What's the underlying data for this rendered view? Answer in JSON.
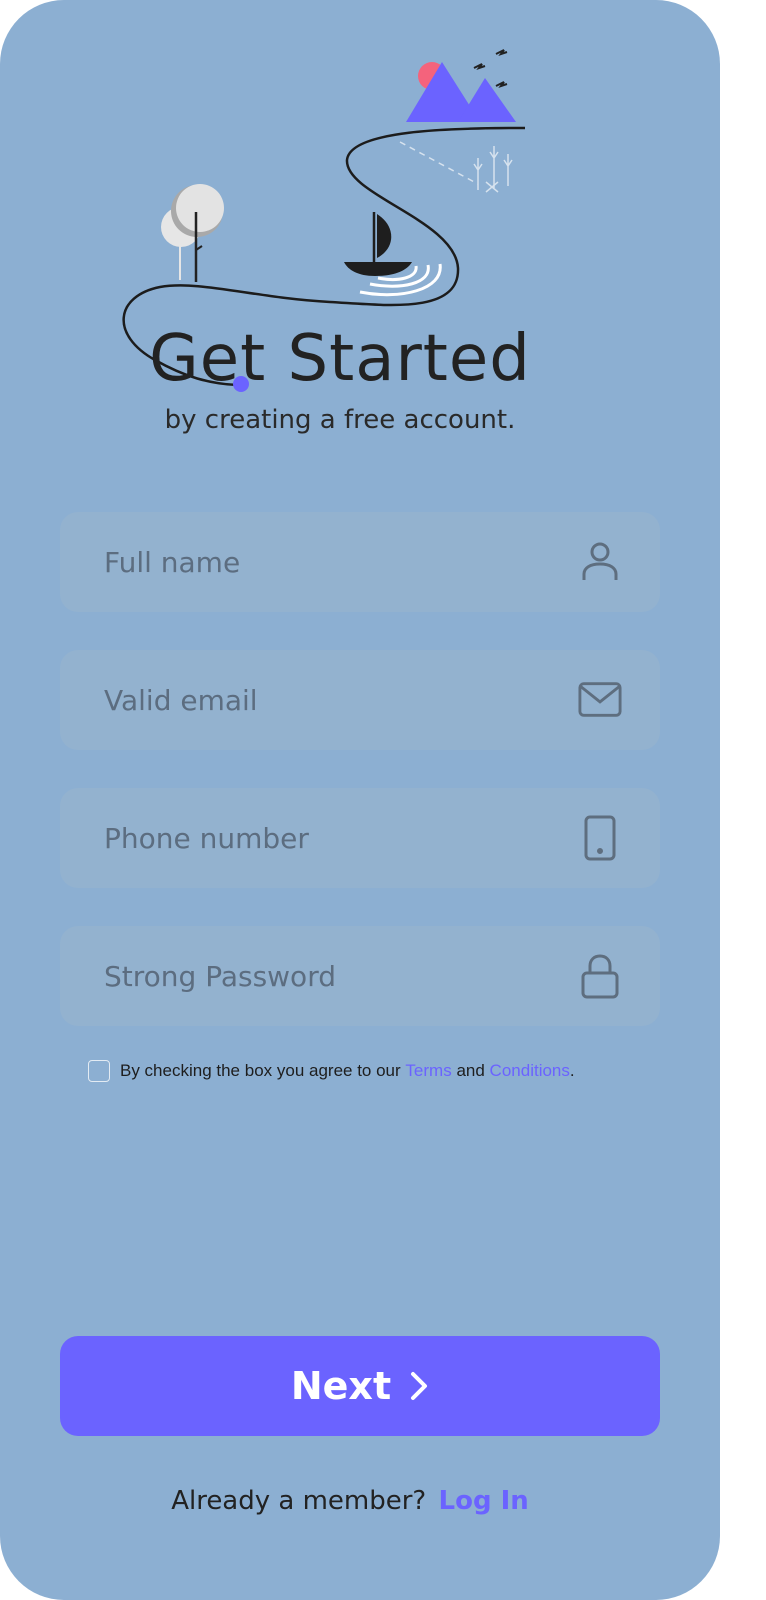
{
  "header": {
    "title": "Get Started",
    "subtitle": "by creating a free account."
  },
  "form": {
    "fields": [
      {
        "placeholder": "Full name",
        "icon": "user-icon"
      },
      {
        "placeholder": "Valid email",
        "icon": "mail-icon"
      },
      {
        "placeholder": "Phone number",
        "icon": "phone-icon"
      },
      {
        "placeholder": "Strong Password",
        "icon": "lock-icon"
      }
    ],
    "terms": {
      "prefix": "By checking the box you agree to our",
      "terms_link": "Terms",
      "and": "and",
      "conditions_link": "Conditions",
      "suffix": "."
    }
  },
  "actions": {
    "next_label": "Next",
    "login_prompt": "Already a member?",
    "login_link": "Log In"
  },
  "colors": {
    "background": "#8cafd2",
    "field": "#93b2cf",
    "accent": "#6b63ff",
    "sun": "#f4637c",
    "text": "#222222"
  }
}
